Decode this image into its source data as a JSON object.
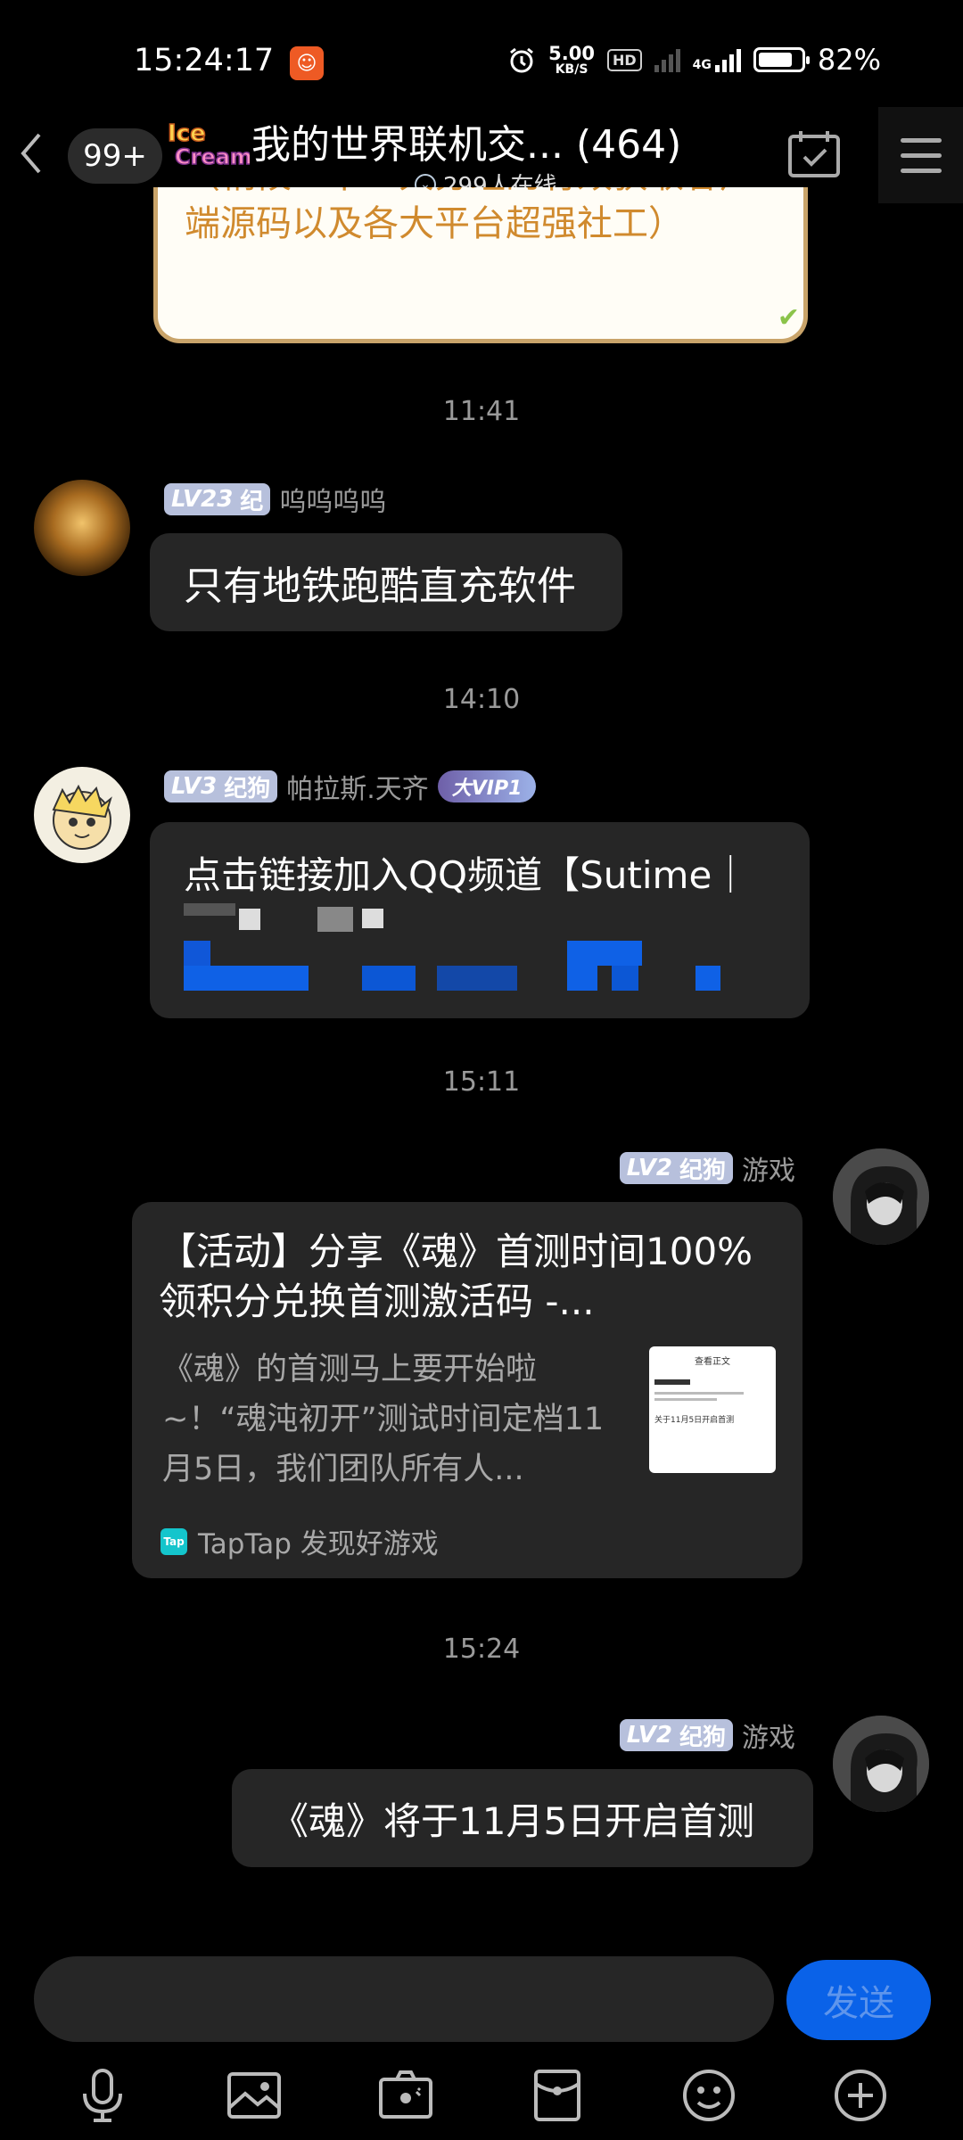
{
  "status_bar": {
    "time": "15:24:17",
    "net_speed_value": "5.00",
    "net_speed_unit": "KB/S",
    "hd_label": "HD",
    "network_label": "4G",
    "battery": "82%",
    "battery_level": 0.82
  },
  "header": {
    "unread_count": "99+",
    "group_logo_text": "Ice Cream",
    "group_title": "我的世界联机交... (464)",
    "online_text": "299人在线"
  },
  "promo_card": {
    "text": "（稍候一下一大分组的有效获取客户端源码以及各大平台超强社工）"
  },
  "messages": [
    {
      "time": "11:41",
      "level": "LV23",
      "title": "纪",
      "nickname": "呜呜呜呜",
      "text": "只有地铁跑酷直充软件"
    },
    {
      "time": "14:10",
      "level": "LV3",
      "title": "纪狗",
      "nickname": "帕拉斯.天齐",
      "vip": "大VIP1",
      "text": "点击链接加入QQ频道【Sutime｜"
    },
    {
      "time": "15:11",
      "level": "LV2",
      "title": "纪狗",
      "nickname": "游戏",
      "card": {
        "title": "【活动】分享《魂》首测时间100%领积分兑换首测激活码 -...",
        "description": "《魂》的首测马上要开始啦~！“魂沌初开”测试时间定档11月5日，我们团队所有人...",
        "thumb_header": "查看正文",
        "thumb_line": "关于11月5日开启首测",
        "source": "TapTap 发现好游戏",
        "source_icon": "Tap"
      }
    },
    {
      "time": "15:24",
      "level": "LV2",
      "title": "纪狗",
      "nickname": "游戏",
      "text": "《魂》将于11月5日开启首测"
    }
  ],
  "composer": {
    "placeholder": "",
    "send_label": "发送"
  },
  "toolbar": {
    "icons": [
      "microphone-icon",
      "image-icon",
      "camera-icon",
      "red-packet-icon",
      "emoji-icon",
      "plus-icon"
    ]
  }
}
